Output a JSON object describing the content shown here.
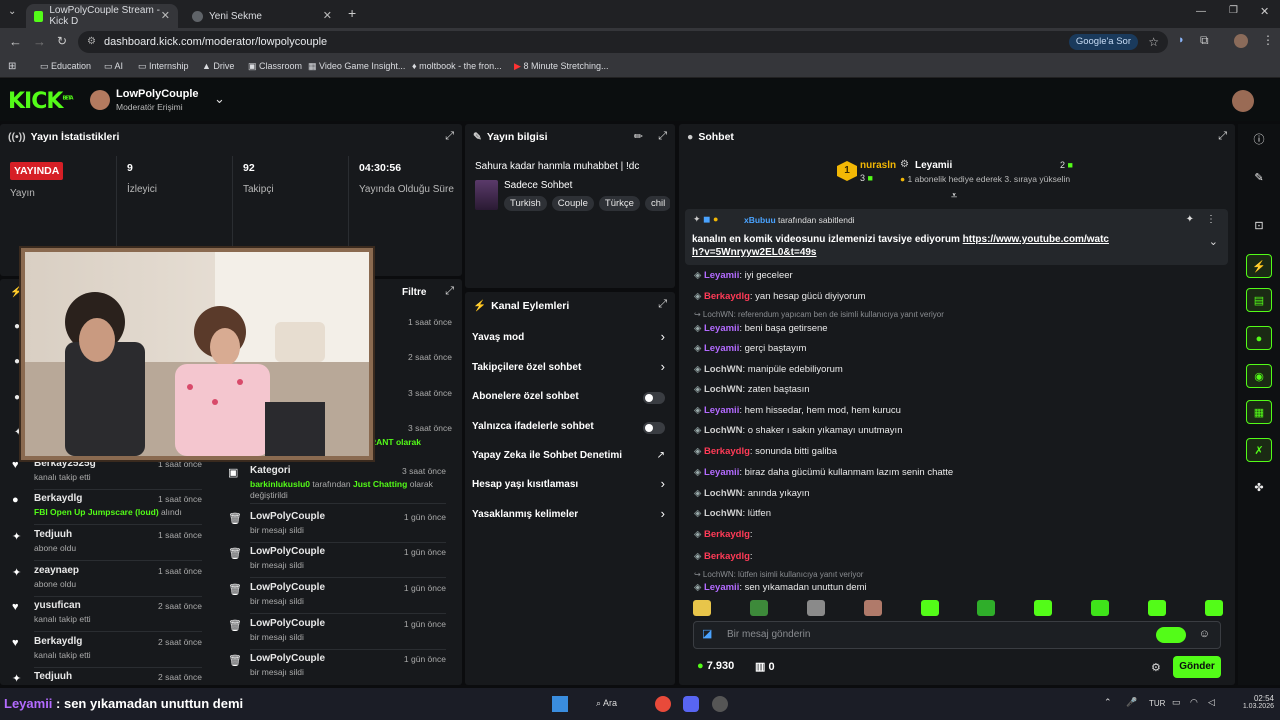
{
  "browser": {
    "tabs": [
      {
        "label": "LowPolyCouple Stream - Kick D",
        "active": true
      },
      {
        "label": "Yeni Sekme",
        "active": false
      }
    ],
    "url": "dashboard.kick.com/moderator/lowpolycouple",
    "google_btn": "Google'a Sor",
    "bookmarks": [
      "Education",
      "AI",
      "Internship",
      "Drive",
      "Classroom",
      "Video Game Insight...",
      "moltbook - the fron...",
      "8 Minute Stretching..."
    ]
  },
  "kick": {
    "logo": "KICK",
    "logo_tag": "BETA",
    "channel": "LowPolyCouple",
    "role": "Moderatör Erişimi"
  },
  "stats": {
    "title": "Yayın İstatistikleri",
    "items": [
      {
        "value": "YAYINDA",
        "label": "Yayın"
      },
      {
        "value": "9",
        "label": "İzleyici"
      },
      {
        "value": "92",
        "label": "Takipçi"
      },
      {
        "value": "04:30:56",
        "label": "Yayında Olduğu Süre"
      }
    ]
  },
  "streaminfo": {
    "title": "Yayın bilgisi",
    "stream_title": "Sahura kadar hanmla muhabbet | !dc",
    "category": "Sadece Sohbet",
    "tags": [
      "Turkish",
      "Couple",
      "Türkçe",
      "chil"
    ]
  },
  "feed": {
    "filter": "Filtre",
    "left_times": [
      "1 saat önce",
      "2 saat önce",
      "3 saat önce",
      "3 saat önce"
    ],
    "left": [
      {
        "name": "Berkay2525g",
        "sub": "kanalı takip etti",
        "time": "1 saat önce",
        "icon": "♥"
      },
      {
        "name": "Berkaydlg",
        "sub_pre": "FBI Open Up Jumpscare (loud)",
        "sub": " alındı",
        "time": "1 saat önce",
        "icon": "●"
      },
      {
        "name": "Tedjuuh",
        "sub": "abone oldu",
        "time": "1 saat önce",
        "icon": "✦"
      },
      {
        "name": "zeaynaep",
        "sub": "abone oldu",
        "time": "1 saat önce",
        "icon": "✦"
      },
      {
        "name": "yusufican",
        "sub": "kanalı takip etti",
        "time": "2 saat önce",
        "icon": "♥"
      },
      {
        "name": "Berkaydlg",
        "sub": "kanalı takip etti",
        "time": "2 saat önce",
        "icon": "♥"
      },
      {
        "name": "Tedjuuh",
        "sub": "",
        "time": "2 saat önce",
        "icon": "✦"
      }
    ],
    "mid_partial": "RANT olarak",
    "mid": [
      {
        "name": "Kategori",
        "sub_user": "barkinlukuslu0",
        "sub_mid": " tarafından ",
        "sub_green": "Just Chatting",
        "sub_end": " olarak değiştirildi",
        "time": "3 saat önce"
      },
      {
        "name": "LowPolyCouple",
        "sub": "bir mesajı sildi",
        "time": "1 gün önce"
      },
      {
        "name": "LowPolyCouple",
        "sub": "bir mesajı sildi",
        "time": "1 gün önce"
      },
      {
        "name": "LowPolyCouple",
        "sub": "bir mesajı sildi",
        "time": "1 gün önce"
      },
      {
        "name": "LowPolyCouple",
        "sub": "bir mesajı sildi",
        "time": "1 gün önce"
      },
      {
        "name": "LowPolyCouple",
        "sub": "bir mesajı sildi",
        "time": "1 gün önce"
      }
    ]
  },
  "actions": {
    "title": "Kanal Eylemleri",
    "items": [
      "Yavaş mod",
      "Takipçilere özel sohbet",
      "Abonelere özel sohbet",
      "Yalnızca ifadelerle sohbet",
      "Yapay Zeka ile Sohbet Denetimi",
      "Hesap yaşı kısıtlaması",
      "Yasaklanmış kelimeler"
    ]
  },
  "chat": {
    "title": "Sohbet",
    "top1_name": "nurasln",
    "top1_count": "3",
    "top2_name": "Leyamii",
    "top2_count": "2",
    "top2_sub": "1 abonelik hediye ederek 3. sıraya yükselin",
    "pin_by_user": "xBubuu",
    "pin_by": " tarafından sabitlendi",
    "pin_text": "kanalın en komik videosunu izlemenizi tavsiye ediyorum ",
    "pin_link": "https://www.youtube.com/watch?v=5Wnryyw2EL0&t=49s",
    "messages": [
      {
        "u": "Leyamii",
        "c": "lv",
        "t": ": iyi geceleer"
      },
      {
        "u": "Berkaydlg",
        "c": "bk",
        "t": ": yan hesap gücü diyiyorum"
      },
      {
        "reply": "LochWN: referendum yapıcam ben de isimli kullanıcıya yanıt veriyor"
      },
      {
        "u": "Leyamii",
        "c": "lv",
        "t": ": beni başa getirsene"
      },
      {
        "u": "Leyamii",
        "c": "lv",
        "t": ": gerçi baştayım"
      },
      {
        "u": "LochWN",
        "c": "lw",
        "t": ": manipüle edebiliyorum"
      },
      {
        "u": "LochWN",
        "c": "lw",
        "t": ": zaten baştasın"
      },
      {
        "u": "Leyamii",
        "c": "lv",
        "t": ": hem hissedar, hem mod, hem kurucu"
      },
      {
        "u": "LochWN",
        "c": "lw",
        "t": ": o shaker ı sakın yıkamayı unutmayın"
      },
      {
        "u": "Berkaydlg",
        "c": "bk",
        "t": ": sonunda bitti galiba"
      },
      {
        "u": "Leyamii",
        "c": "lv",
        "t": ": biraz daha gücümü kullanmam lazım senin chatte"
      },
      {
        "u": "LochWN",
        "c": "lw",
        "t": ": anında yıkayın"
      },
      {
        "u": "LochWN",
        "c": "lw",
        "t": ": lütfen"
      },
      {
        "u": "Berkaydlg",
        "c": "bk",
        "t": ":"
      },
      {
        "u": "Berkaydlg",
        "c": "bk",
        "t": ":"
      },
      {
        "reply": "LochWN: lütfen isimli kullanıcıya yanıt veriyor"
      },
      {
        "u": "Leyamii",
        "c": "lv",
        "t": ": sen yıkamadan unuttun demi"
      }
    ],
    "input_placeholder": "Bir mesaj gönderin",
    "points": "7.930",
    "shop_count": "0",
    "send": "Gönder"
  },
  "overlay": {
    "user": "Leyamii",
    "text": " : sen yıkamadan unuttun demi"
  },
  "taskbar": {
    "search": "Ara",
    "lang": "TUR",
    "time": "02:54",
    "date": "1.03.2026"
  },
  "colors": {
    "accent": "#53fc18",
    "live": "#d61f26",
    "panel": "#17191c"
  }
}
